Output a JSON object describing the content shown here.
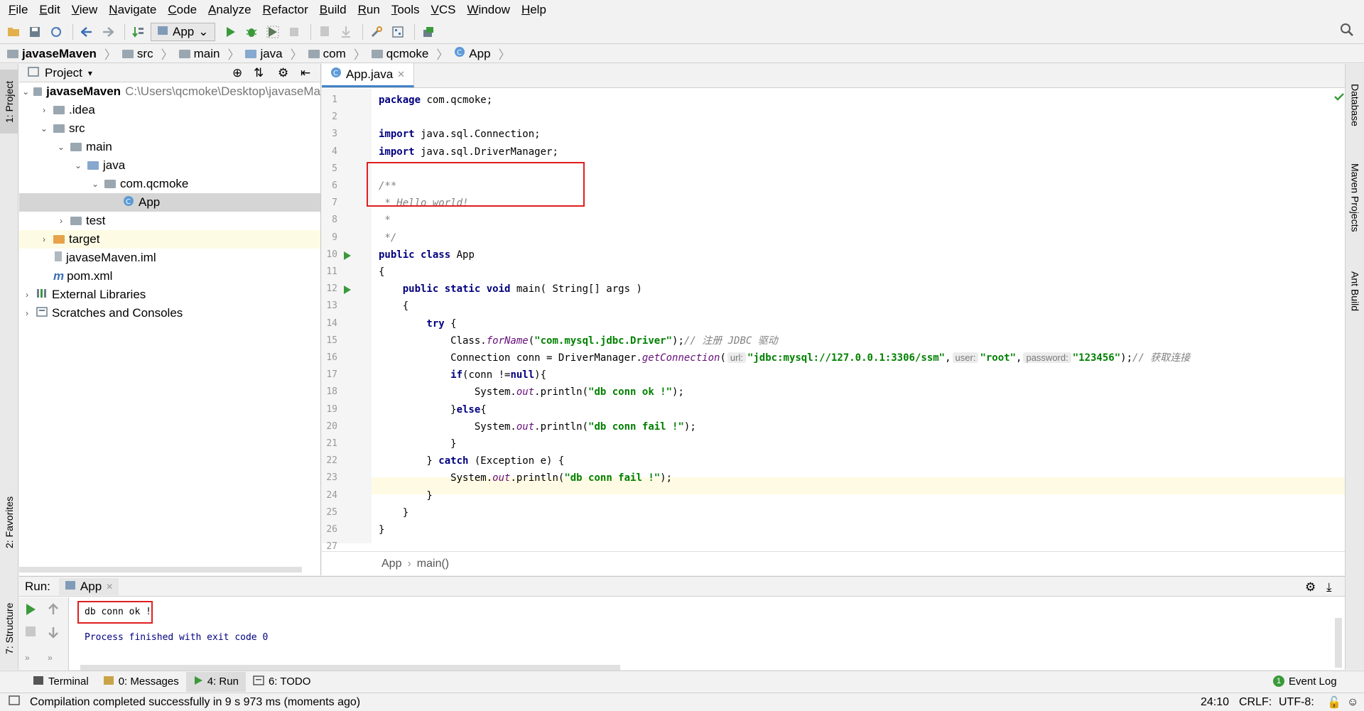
{
  "menu": [
    "File",
    "Edit",
    "View",
    "Navigate",
    "Code",
    "Analyze",
    "Refactor",
    "Build",
    "Run",
    "Tools",
    "VCS",
    "Window",
    "Help"
  ],
  "toolbar": {
    "run_config": "App"
  },
  "breadcrumbs": [
    "javaseMaven",
    "src",
    "main",
    "java",
    "com",
    "qcmoke",
    "App"
  ],
  "left_strip": {
    "project": "1: Project",
    "favorites": "2: Favorites",
    "structure": "7: Structure"
  },
  "right_strip": {
    "database": "Database",
    "maven": "Maven Projects",
    "ant": "Ant Build"
  },
  "project_panel": {
    "title": "Project",
    "tree": [
      {
        "label": "javaseMaven",
        "path": "C:\\Users\\qcmoke\\Desktop\\javaseMa"
      },
      {
        "label": ".idea"
      },
      {
        "label": "src"
      },
      {
        "label": "main"
      },
      {
        "label": "java"
      },
      {
        "label": "com.qcmoke"
      },
      {
        "label": "App"
      },
      {
        "label": "test"
      },
      {
        "label": "target"
      },
      {
        "label": "javaseMaven.iml"
      },
      {
        "label": "pom.xml"
      },
      {
        "label": "External Libraries"
      },
      {
        "label": "Scratches and Consoles"
      }
    ]
  },
  "editor": {
    "tab": "App.java",
    "line_numbers": [
      "1",
      "2",
      "3",
      "4",
      "5",
      "6",
      "7",
      "8",
      "9",
      "10",
      "11",
      "12",
      "13",
      "14",
      "15",
      "16",
      "17",
      "18",
      "19",
      "20",
      "21",
      "22",
      "23",
      "24",
      "25",
      "26",
      "27"
    ],
    "code": {
      "l1a": "package",
      "l1b": " com.qcmoke;",
      "l3a": "import",
      "l3b": " java.sql.Connection;",
      "l4a": "import",
      "l4b": " java.sql.DriverManager;",
      "l6": "/**",
      "l7": " * Hello world!",
      "l8": " *",
      "l9": " */",
      "l10a": "public class",
      "l10b": " App",
      "l11": "{",
      "l12a": "    public static void",
      "l12b": " main( String[] args )",
      "l13": "    {",
      "l14a": "        try",
      "l14b": " {",
      "l15a": "            Class.",
      "l15b": "forName",
      "l15c": "(",
      "l15d": "\"com.mysql.jdbc.Driver\"",
      "l15e": ");",
      "l15f": "// 注册 JDBC 驱动",
      "l16a": "            Connection conn = DriverManager.",
      "l16b": "getConnection",
      "l16c": "(",
      "l16h1": "url:",
      "l16d": "\"jdbc:mysql://127.0.0.1:3306/ssm\"",
      "l16e": ",",
      "l16h2": "user:",
      "l16f": "\"root\"",
      "l16g": ",",
      "l16h3": "password:",
      "l16i": "\"123456\"",
      "l16j": ");",
      "l16k": "// 获取连接",
      "l17a": "            if",
      "l17b": "(conn !=",
      "l17c": "null",
      "l17d": "){",
      "l18a": "                System.",
      "l18b": "out",
      "l18c": ".println(",
      "l18d": "\"db conn ok !\"",
      "l18e": ");",
      "l19a": "            }",
      "l19b": "else",
      "l19c": "{",
      "l20a": "                System.",
      "l20b": "out",
      "l20c": ".println(",
      "l20d": "\"db conn fail !\"",
      "l20e": ");",
      "l21": "            }",
      "l22a": "        } ",
      "l22b": "catch",
      "l22c": " (Exception e) {",
      "l23a": "            System.",
      "l23b": "out",
      "l23c": ".println(",
      "l23d": "\"db conn fail !\"",
      "l23e": ");",
      "l24": "        }",
      "l25": "    }",
      "l26": "}"
    },
    "crumb": [
      "App",
      "main()"
    ]
  },
  "run_panel": {
    "label": "Run:",
    "tab": "App",
    "output_line1": "db conn ok !",
    "output_line2": "Process finished with exit code 0"
  },
  "bottom_tools": {
    "terminal": "Terminal",
    "messages": "0: Messages",
    "run": "4: Run",
    "todo": "6: TODO",
    "event_log": "Event Log",
    "event_count": "1"
  },
  "status": {
    "message": "Compilation completed successfully in 9 s 973 ms (moments ago)",
    "position": "24:10",
    "line_sep": "CRLF:",
    "encoding": "UTF-8:"
  },
  "colors": {
    "keyword": "#000080",
    "string": "#008000",
    "comment": "#808080",
    "highlight_box": "#e01e1e",
    "run_green": "#3a9a3a"
  }
}
